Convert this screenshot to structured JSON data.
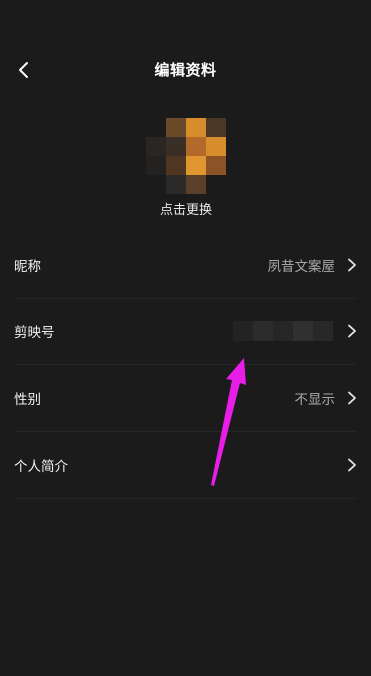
{
  "header": {
    "title": "编辑资料",
    "back_icon": "chevron-left-icon"
  },
  "avatar": {
    "change_label": "点击更换"
  },
  "profile_rows": [
    {
      "label": "昵称",
      "value": "夙昔文案屋"
    },
    {
      "label": "剪映号",
      "value": ""
    },
    {
      "label": "性别",
      "value": "不显示"
    },
    {
      "label": "个人简介",
      "value": ""
    }
  ],
  "colors": {
    "background": "#1b1b1b",
    "text_primary": "#f2f2f2",
    "text_secondary": "#a8a8a8",
    "annotation_arrow": "#e81ee8"
  }
}
